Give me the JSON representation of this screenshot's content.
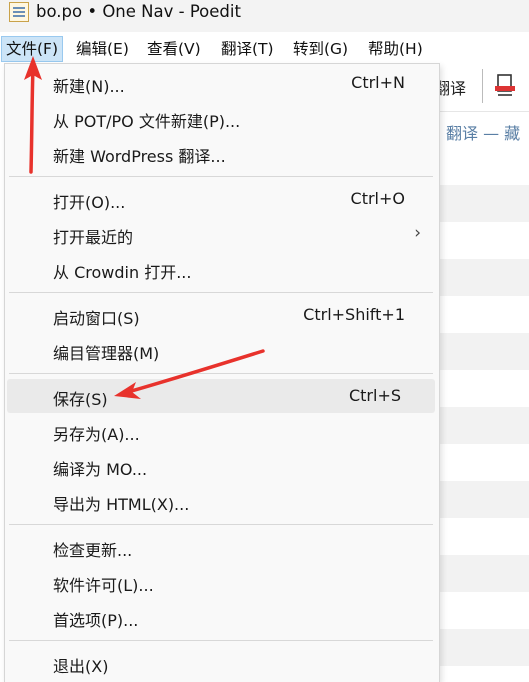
{
  "window": {
    "title": "bo.po • One Nav - Poedit"
  },
  "menubar": {
    "items": [
      "文件(F)",
      "编辑(E)",
      "查看(V)",
      "翻译(T)",
      "转到(G)",
      "帮助(H)"
    ],
    "active_index": 0
  },
  "background": {
    "toolbar_label": "翻译",
    "header_text": "翻译 — 藏"
  },
  "file_menu": {
    "groups": [
      [
        {
          "label": "新建(N)...",
          "shortcut": "Ctrl+N"
        },
        {
          "label": "从 POT/PO 文件新建(P)...",
          "shortcut": ""
        },
        {
          "label": "新建 WordPress 翻译...",
          "shortcut": ""
        }
      ],
      [
        {
          "label": "打开(O)...",
          "shortcut": "Ctrl+O"
        },
        {
          "label": "打开最近的",
          "shortcut": "",
          "submenu": true
        },
        {
          "label": "从 Crowdin 打开...",
          "shortcut": ""
        }
      ],
      [
        {
          "label": "启动窗口(S)",
          "shortcut": "Ctrl+Shift+1"
        },
        {
          "label": "编目管理器(M)",
          "shortcut": ""
        }
      ],
      [
        {
          "label": "保存(S)",
          "shortcut": "Ctrl+S",
          "highlighted": true
        },
        {
          "label": "另存为(A)...",
          "shortcut": ""
        },
        {
          "label": "编译为 MO...",
          "shortcut": ""
        },
        {
          "label": "导出为 HTML(X)...",
          "shortcut": ""
        }
      ],
      [
        {
          "label": "检查更新...",
          "shortcut": ""
        },
        {
          "label": "软件许可(L)...",
          "shortcut": ""
        },
        {
          "label": "首选项(P)...",
          "shortcut": ""
        }
      ],
      [
        {
          "label": "退出(X)",
          "shortcut": ""
        }
      ]
    ]
  },
  "annotation_color": "#e8322c"
}
